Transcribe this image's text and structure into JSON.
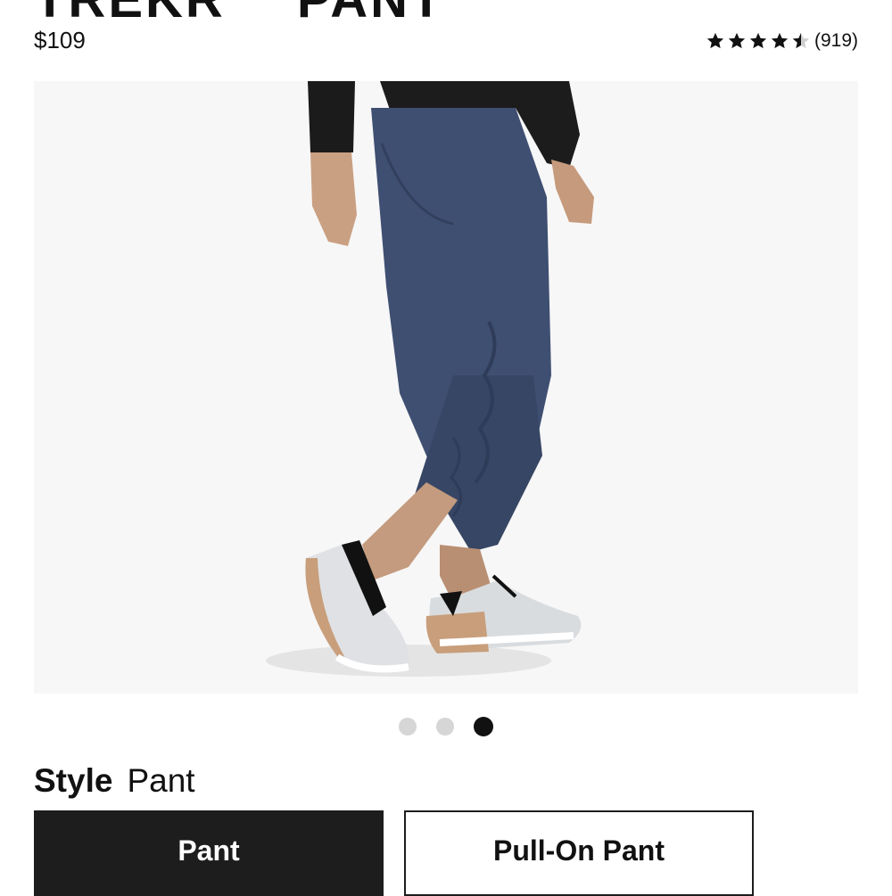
{
  "product": {
    "title": "TREKR™ PANT",
    "price": "$109",
    "rating": {
      "value": 4.5,
      "max": 5,
      "count_label": "(919)"
    }
  },
  "gallery": {
    "image_icon": "product-photo-pants-side-view",
    "dots": [
      {
        "active": false
      },
      {
        "active": false
      },
      {
        "active": true
      }
    ]
  },
  "style": {
    "label": "Style",
    "selected_value": "Pant",
    "options": [
      {
        "label": "Pant",
        "selected": true
      },
      {
        "label": "Pull-On Pant",
        "selected": false
      }
    ]
  },
  "colors": {
    "selected_bg": "#1d1d1d",
    "dot_inactive": "#d6d6d6",
    "dot_active": "#111111",
    "pant_navy": "#3f4f72"
  }
}
